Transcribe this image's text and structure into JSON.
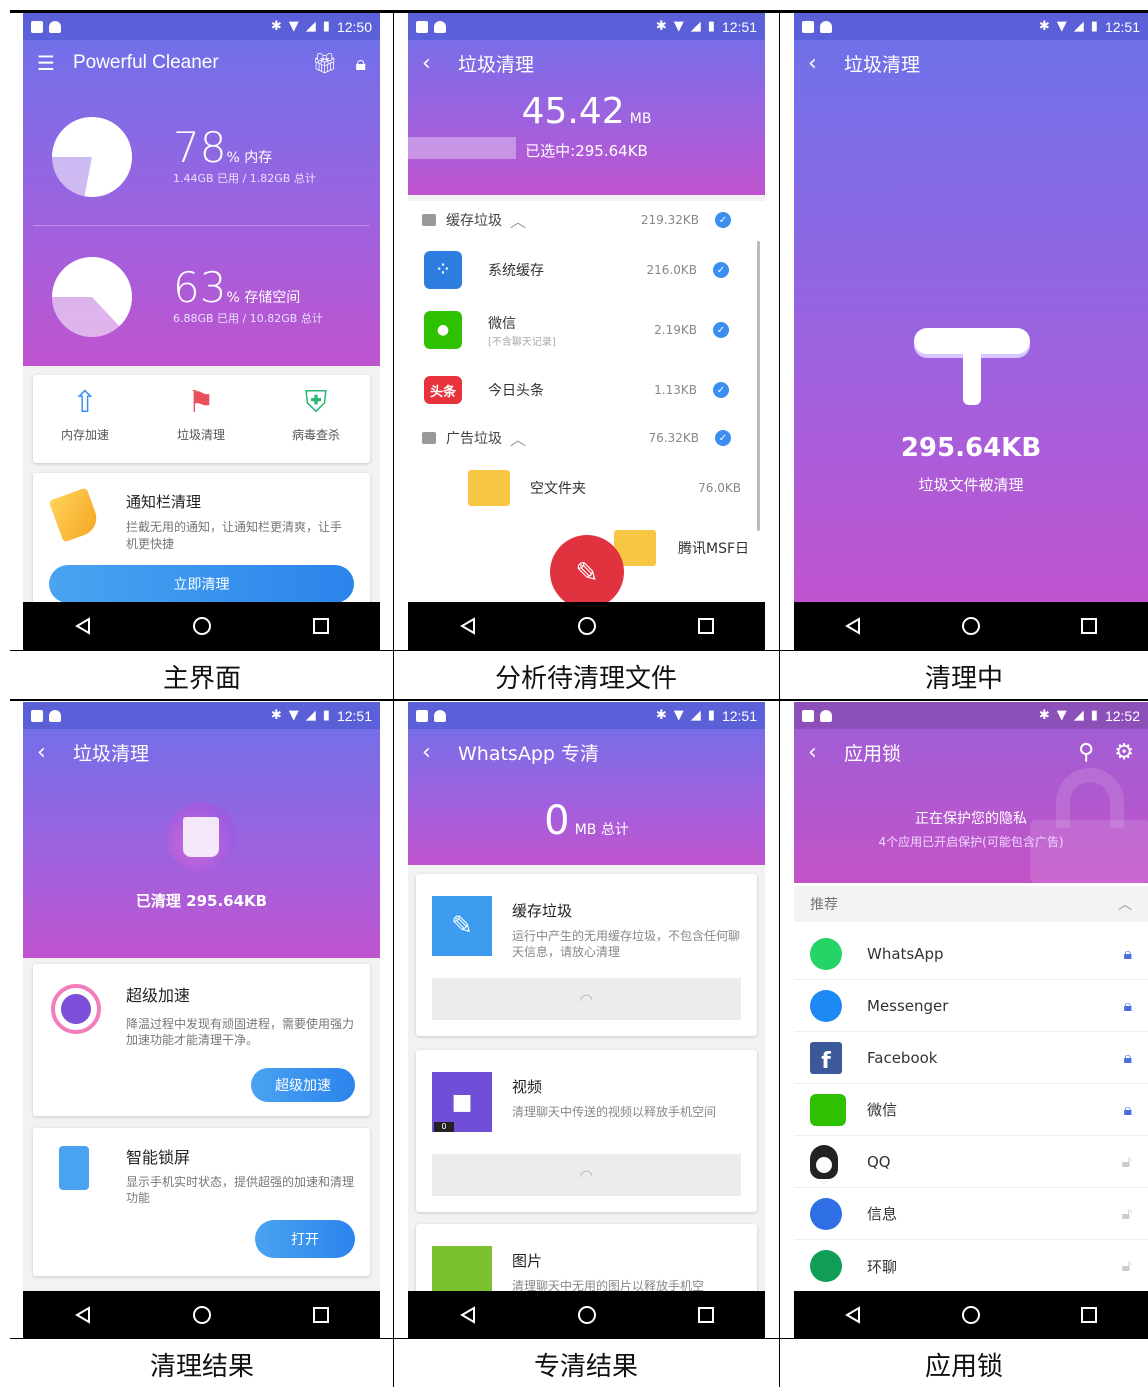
{
  "status": {
    "p1_time": "12:50",
    "p2_time": "12:51",
    "p3_time": "12:51",
    "p4_time": "12:51",
    "p5_time": "12:51",
    "p6_time": "12:52"
  },
  "captions": [
    "主界面",
    "分析待清理文件",
    "清理中",
    "清理结果",
    "专清结果",
    "应用锁"
  ],
  "p1": {
    "title": "Powerful Cleaner",
    "mem_pct": "78",
    "mem_unit": "% 内存",
    "mem_detail": "1.44GB 已用 / 1.82GB 总计",
    "mem_fraction": 0.78,
    "sto_pct": "63",
    "sto_unit": "% 存储空间",
    "sto_detail": "6.88GB 已用 / 10.82GB 总计",
    "sto_fraction": 0.63,
    "tools": [
      "内存加速",
      "垃圾清理",
      "病毒查杀"
    ],
    "notify_title": "通知栏清理",
    "notify_desc": "拦截无用的通知，让通知栏更清爽，让手机更快捷",
    "notify_btn": "立即清理"
  },
  "p2": {
    "title": "垃圾清理",
    "size_value": "45.42",
    "size_unit": "MB",
    "selected": "已选中:295.64KB",
    "groups": [
      {
        "label": "缓存垃圾",
        "size": "219.32KB"
      },
      {
        "label": "广告垃圾",
        "size": "76.32KB"
      }
    ],
    "items": [
      {
        "name": "系统缓存",
        "sub": "",
        "size": "216.0KB"
      },
      {
        "name": "微信",
        "sub": "[不含聊天记录]",
        "size": "2.19KB"
      },
      {
        "name": "今日头条",
        "sub": "",
        "size": "1.13KB"
      }
    ],
    "toutiao_logo": "头条",
    "ad_items": [
      {
        "name": "空文件夹",
        "size": "76.0KB"
      },
      {
        "name": "腾讯MSF日",
        "size": ""
      }
    ]
  },
  "p3": {
    "title": "垃圾清理",
    "amount": "295.64KB",
    "caption": "垃圾文件被清理"
  },
  "p4": {
    "title": "垃圾清理",
    "cleaned": "已清理 295.64KB",
    "card1_title": "超级加速",
    "card1_desc": "降温过程中发现有顽固进程，需要使用强力加速功能才能清理干净。",
    "card1_btn": "超级加速",
    "card2_title": "智能锁屏",
    "card2_desc": "显示手机实时状态，提供超强的加速和清理功能",
    "card2_btn": "打开"
  },
  "p5": {
    "title": "WhatsApp 专清",
    "total_value": "0",
    "total_unit": "MB 总计",
    "cards": [
      {
        "title": "缓存垃圾",
        "desc": "运行中产生的无用缓存垃圾，不包含任何聊天信息，请放心清理"
      },
      {
        "title": "视频",
        "desc": "清理聊天中传送的视频以释放手机空间",
        "badge": "0"
      },
      {
        "title": "图片",
        "desc": "清理聊天中无用的图片以释放手机空"
      }
    ]
  },
  "p6": {
    "title": "应用锁",
    "protect_title": "正在保护您的隐私",
    "protect_sub": "4个应用已开启保护(可能包含广告)",
    "section": "推荐",
    "apps": [
      {
        "name": "WhatsApp",
        "locked": true,
        "color": "#25d366"
      },
      {
        "name": "Messenger",
        "locked": true,
        "color": "#1e88f5"
      },
      {
        "name": "Facebook",
        "locked": true,
        "color": "#3b5998"
      },
      {
        "name": "微信",
        "locked": true,
        "color": "#2dc100"
      },
      {
        "name": "QQ",
        "locked": false,
        "color": "#222222"
      },
      {
        "name": "信息",
        "locked": false,
        "color": "#2f6fe4"
      },
      {
        "name": "环聊",
        "locked": false,
        "color": "#0f9d58"
      }
    ]
  }
}
